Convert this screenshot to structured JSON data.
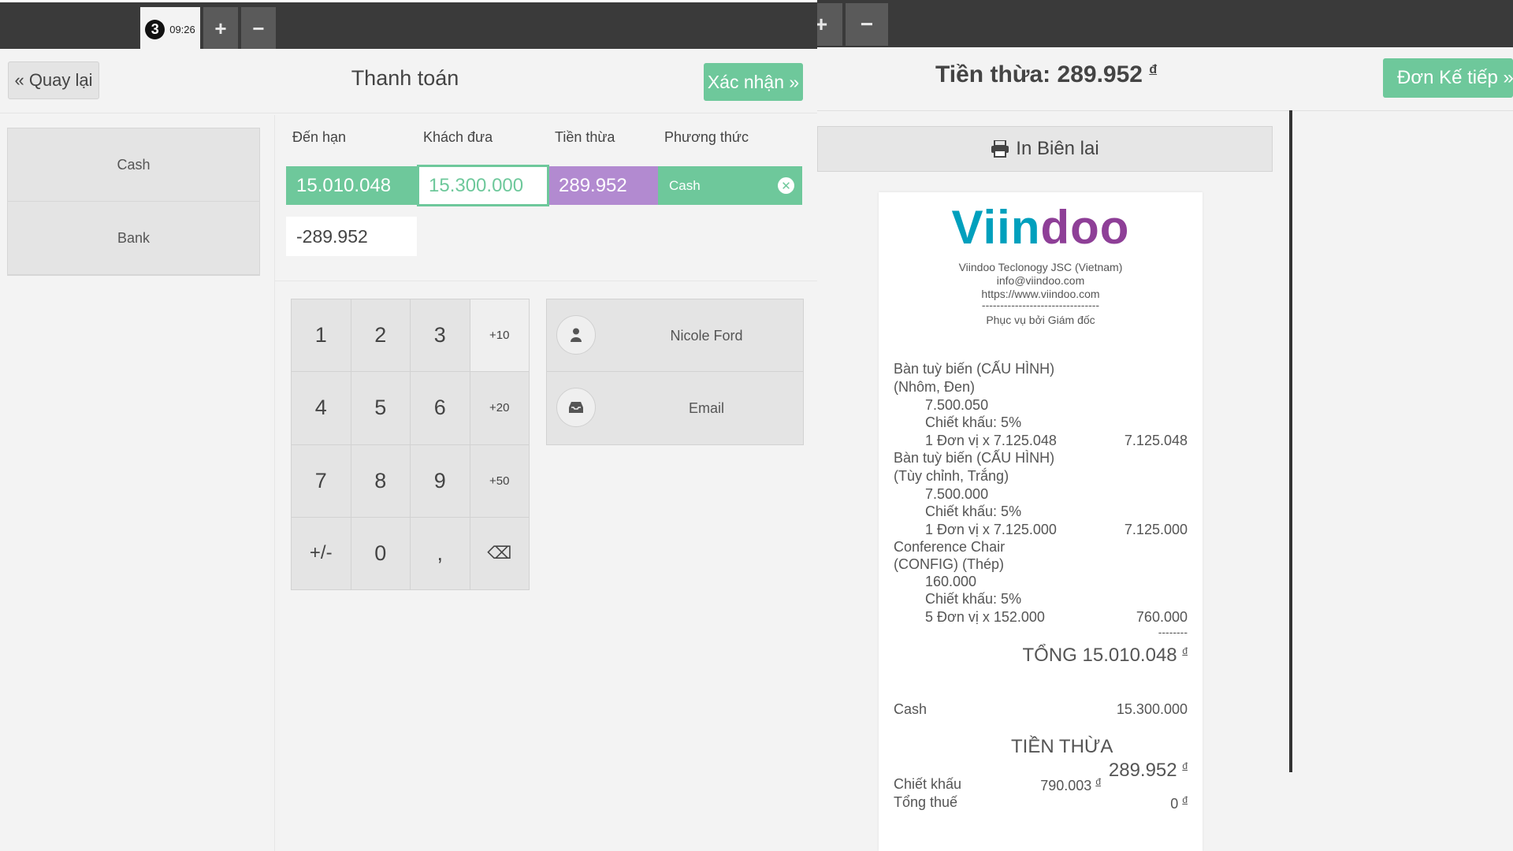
{
  "toolbar": {
    "order_number": "3",
    "order_time": "09:26",
    "add_label": "+",
    "remove_label": "−"
  },
  "payment": {
    "back_label": "« Quay lại",
    "title": "Thanh toán",
    "confirm_label": "Xác nhận »",
    "methods": [
      "Cash",
      "Bank"
    ],
    "columns": {
      "due": "Đến hạn",
      "tendered": "Khách đưa",
      "change": "Tiền thừa",
      "method": "Phương thức"
    },
    "line": {
      "due": "15.010.048",
      "tendered": "15.300.000",
      "change": "289.952",
      "method": "Cash"
    },
    "remaining": "-289.952",
    "numpad": [
      "1",
      "2",
      "3",
      "+10",
      "4",
      "5",
      "6",
      "+20",
      "7",
      "8",
      "9",
      "+50",
      "+/-",
      "0",
      ",",
      "⌫"
    ],
    "client_name": "Nicole Ford",
    "email_label": "Email"
  },
  "receipt_screen": {
    "change_label": "Tiền thừa: 289.952",
    "currency": "đ",
    "next_label": "Đơn Kế tiếp »",
    "print_label": "In Biên lai"
  },
  "receipt": {
    "logo_part1": "Viin",
    "logo_part2": "doo",
    "company": "Viindoo Teclonogy JSC (Vietnam)",
    "email": "info@viindoo.com",
    "website": "https://www.viindoo.com",
    "separator": "--------------------------------",
    "served_by": "Phục vụ bởi Giám đốc",
    "items": [
      {
        "name1": "Bàn tuỳ biến (CẤU HÌNH)",
        "name2": "(Nhôm, Đen)",
        "price": "7.500.050",
        "discount": "Chiết khấu: 5%",
        "qty_line": "1 Đơn vị x 7.125.048",
        "total": "7.125.048"
      },
      {
        "name1": "Bàn tuỳ biến (CẤU HÌNH)",
        "name2": "(Tùy chỉnh, Trắng)",
        "price": "7.500.000",
        "discount": "Chiết khấu: 5%",
        "qty_line": "1 Đơn vị x 7.125.000",
        "total": "7.125.000"
      },
      {
        "name1": "Conference Chair",
        "name2": "(CONFIG) (Thép)",
        "price": "160.000",
        "discount": "Chiết khấu: 5%",
        "qty_line": "5 Đơn vị x 152.000",
        "total": "760.000"
      }
    ],
    "dashes": "--------",
    "total_label": "TỔNG",
    "total_value": "15.010.048",
    "payment_method": "Cash",
    "payment_value": "15.300.000",
    "change_label": "TIỀN THỪA",
    "change_value": "289.952",
    "discount_label": "Chiết khấu",
    "discount_value": "790.003",
    "tax_label": "Tổng thuế",
    "tax_value": "0",
    "currency": "đ"
  }
}
